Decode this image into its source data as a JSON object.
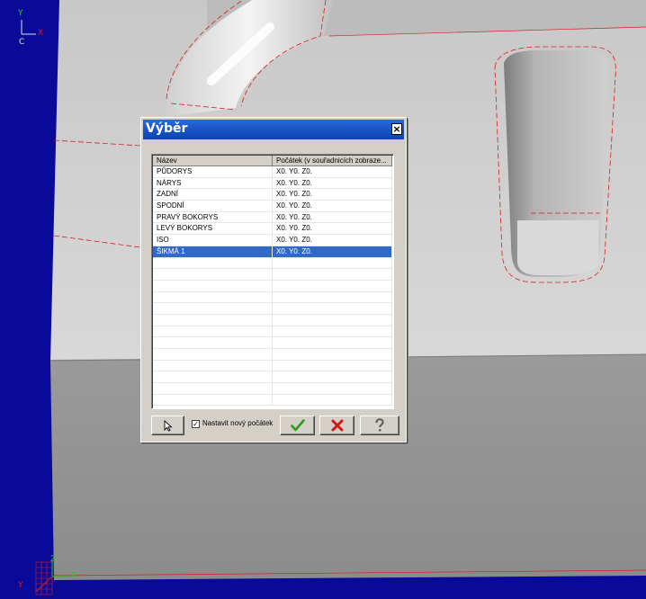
{
  "viewport": {
    "axis_top": {
      "y": "Y",
      "x": "X",
      "z": "C"
    },
    "axis_bottom": {
      "z": "Z",
      "x": "X",
      "y": "Y"
    }
  },
  "dialog": {
    "title": "Výběr",
    "close_label": "×",
    "columns": [
      "Název",
      "Počátek (v souřadnicích zobraze..."
    ],
    "rows": [
      {
        "name": "PŮDORYS",
        "origin": "X0. Y0. Z0.",
        "selected": false
      },
      {
        "name": "NÁRYS",
        "origin": "X0. Y0. Z0.",
        "selected": false
      },
      {
        "name": "ZADNÍ",
        "origin": "X0. Y0. Z0.",
        "selected": false
      },
      {
        "name": "SPODNÍ",
        "origin": "X0. Y0. Z0.",
        "selected": false
      },
      {
        "name": "PRAVÝ BOKORYS",
        "origin": "X0. Y0. Z0.",
        "selected": false
      },
      {
        "name": "LEVÝ BOKORYS",
        "origin": "X0. Y0. Z0.",
        "selected": false
      },
      {
        "name": "ISO",
        "origin": "X0. Y0. Z0.",
        "selected": false
      },
      {
        "name": "ŠIKMÁ 1",
        "origin": "X0. Y0. Z0.",
        "selected": true
      }
    ],
    "checkbox": {
      "label": "Nastavit nový počátek",
      "checked": true,
      "mark": "✓"
    },
    "buttons": {
      "ok_icon": "checkmark-icon",
      "cancel_icon": "x-icon",
      "help_icon": "question-icon",
      "select_icon": "cursor-arrow-icon"
    },
    "colors": {
      "selected_row": "#316ac5",
      "titlebar": "#1a56c8",
      "ok_green": "#2f9a1a",
      "cancel_red": "#d01818"
    }
  }
}
